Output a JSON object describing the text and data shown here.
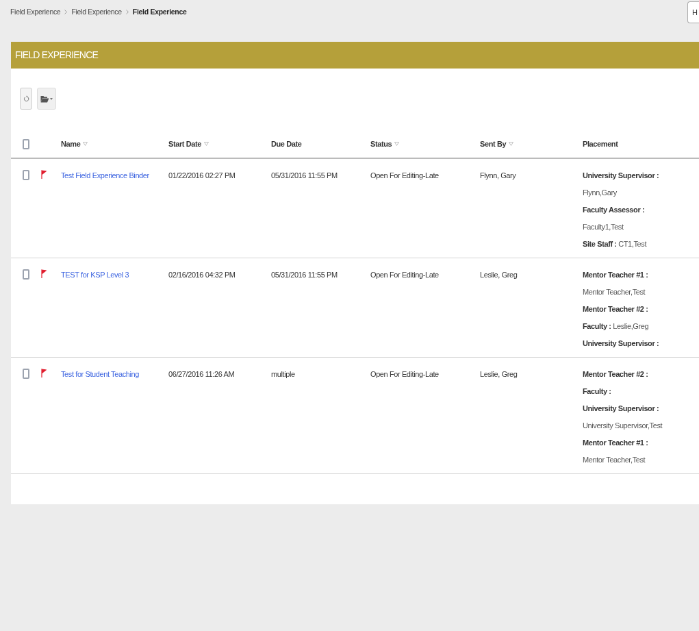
{
  "breadcrumbs": [
    {
      "label": "Field Experience",
      "current": false
    },
    {
      "label": "Field Experience",
      "current": false
    },
    {
      "label": "Field Experience",
      "current": true
    }
  ],
  "help_button": "H",
  "panel": {
    "title": "FIELD EXPERIENCE"
  },
  "table": {
    "select_all": {
      "checked": false
    },
    "columns": [
      {
        "label": "Name",
        "sortable": true
      },
      {
        "label": "Start Date",
        "sortable": true
      },
      {
        "label": "Due Date",
        "sortable": false
      },
      {
        "label": "Status",
        "sortable": true
      },
      {
        "label": "Sent By",
        "sortable": true
      },
      {
        "label": "Placement",
        "sortable": false
      }
    ],
    "rows": [
      {
        "checked": false,
        "flagged": true,
        "name": "Test Field Experience Binder",
        "start_date": "01/22/2016 02:27 PM",
        "due_date": "05/31/2016 11:55 PM",
        "status": "Open For Editing-Late",
        "sent_by": "Flynn, Gary",
        "placement": [
          {
            "label": "University Supervisor :"
          },
          {
            "value": "Flynn,Gary"
          },
          {
            "label": "Faculty Assessor :"
          },
          {
            "value": "Faculty1,Test"
          },
          {
            "label": "Site Staff :",
            "value": "CT1,Test"
          }
        ]
      },
      {
        "checked": false,
        "flagged": true,
        "name": "TEST for KSP Level 3",
        "start_date": "02/16/2016 04:32 PM",
        "due_date": "05/31/2016 11:55 PM",
        "status": "Open For Editing-Late",
        "sent_by": "Leslie, Greg",
        "placement": [
          {
            "label": "Mentor Teacher #1 :"
          },
          {
            "value": "Mentor Teacher,Test"
          },
          {
            "label": "Mentor Teacher #2 :"
          },
          {
            "label": "Faculty :",
            "value": "Leslie,Greg"
          },
          {
            "label": "University Supervisor :"
          }
        ]
      },
      {
        "checked": false,
        "flagged": true,
        "name": "Test for Student Teaching",
        "start_date": "06/27/2016 11:26 AM",
        "due_date": "multiple",
        "status": "Open For Editing-Late",
        "sent_by": "Leslie, Greg",
        "placement": [
          {
            "label": "Mentor Teacher #2 :"
          },
          {
            "label": "Faculty :"
          },
          {
            "label": "University Supervisor :"
          },
          {
            "value": "University Supervisor,Test"
          },
          {
            "label": "Mentor Teacher #1 :"
          },
          {
            "value": "Mentor Teacher,Test"
          }
        ]
      }
    ]
  }
}
